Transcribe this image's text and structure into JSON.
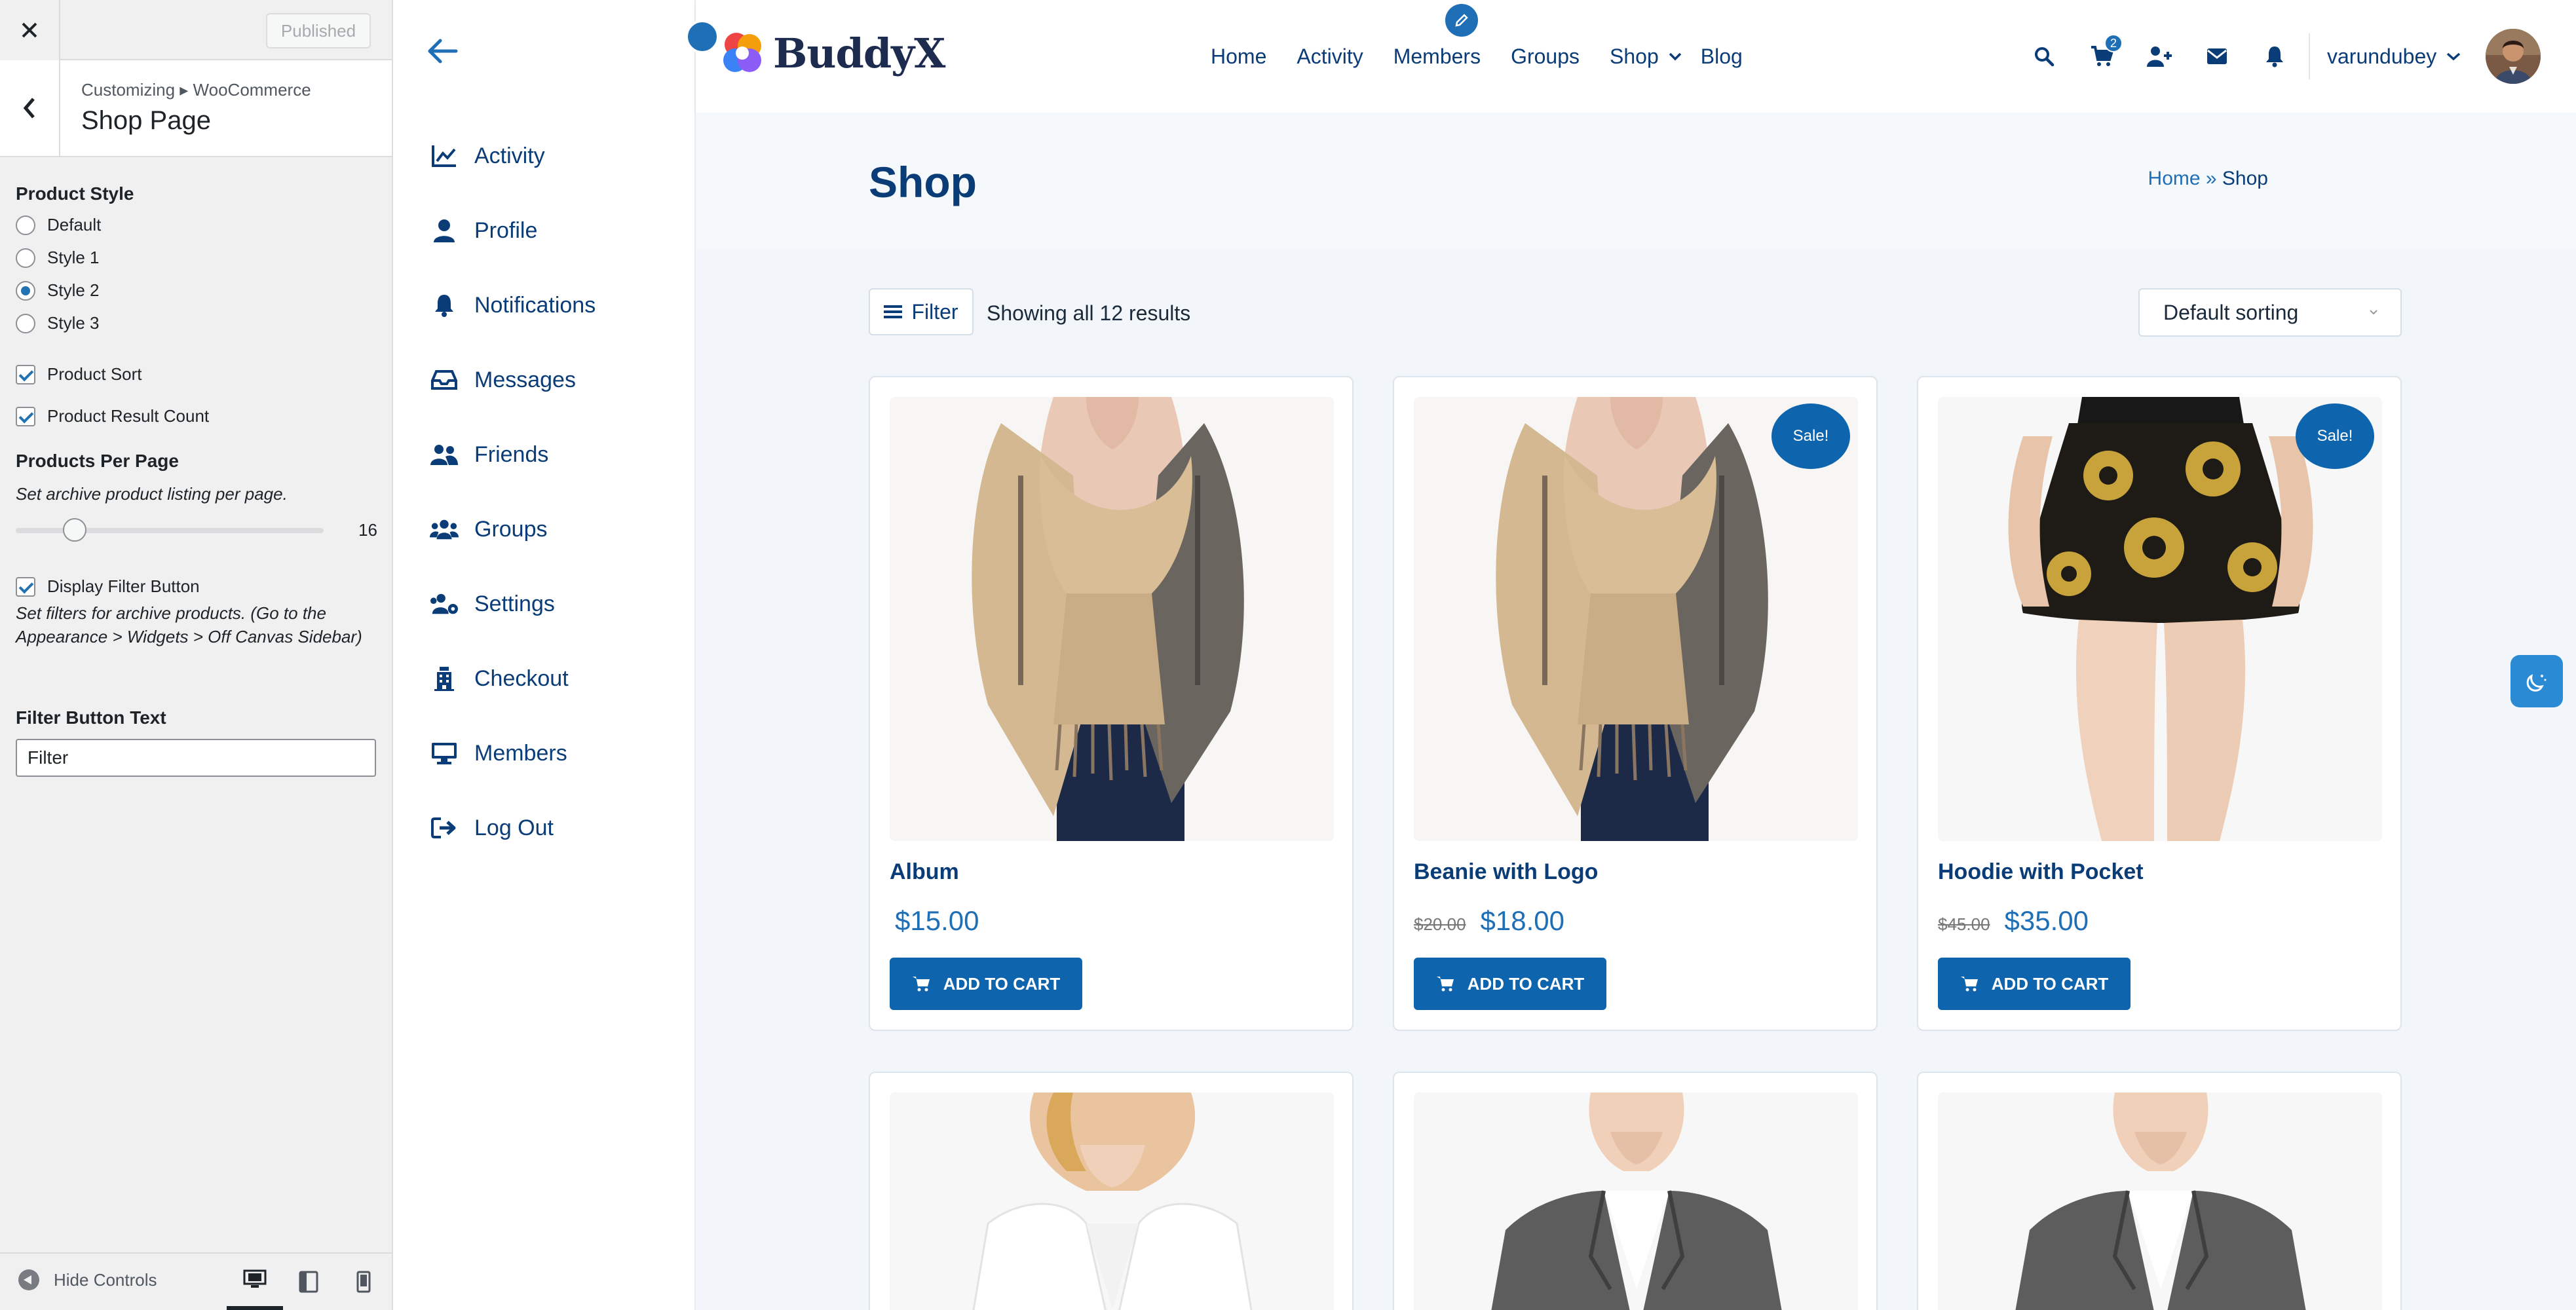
{
  "customizer": {
    "published_label": "Published",
    "breadcrumb": "Customizing ▸ WooCommerce",
    "title": "Shop Page",
    "product_style": {
      "heading": "Product Style",
      "options": [
        "Default",
        "Style 1",
        "Style 2",
        "Style 3"
      ],
      "selected": "Style 2"
    },
    "product_sort_label": "Product Sort",
    "product_result_count_label": "Product Result Count",
    "products_per_page": {
      "heading": "Products Per Page",
      "description": "Set archive product listing per page.",
      "value": "16"
    },
    "display_filter_label": "Display Filter Button",
    "display_filter_description": "Set filters for archive products. (Go to the Appearance > Widgets > Off Canvas Sidebar)",
    "filter_button_text": {
      "heading": "Filter Button Text",
      "value": "Filter"
    },
    "hide_controls_label": "Hide Controls"
  },
  "side_menu": {
    "items": [
      {
        "label": "Activity",
        "icon": "chart-line-icon"
      },
      {
        "label": "Profile",
        "icon": "user-icon"
      },
      {
        "label": "Notifications",
        "icon": "bell-icon"
      },
      {
        "label": "Messages",
        "icon": "inbox-icon"
      },
      {
        "label": "Friends",
        "icon": "user-friends-icon"
      },
      {
        "label": "Groups",
        "icon": "users-icon"
      },
      {
        "label": "Settings",
        "icon": "users-cog-icon"
      },
      {
        "label": "Checkout",
        "icon": "building-icon"
      },
      {
        "label": "Members",
        "icon": "desktop-icon"
      },
      {
        "label": "Log Out",
        "icon": "sign-out-icon"
      }
    ]
  },
  "header": {
    "logo_text": "BuddyX",
    "nav": [
      "Home",
      "Activity",
      "Members",
      "Groups",
      "Shop",
      "Blog"
    ],
    "cart_count": "2",
    "username": "varundubey"
  },
  "page": {
    "title": "Shop",
    "breadcrumb_home": "Home",
    "breadcrumb_sep": " » ",
    "breadcrumb_current": "Shop"
  },
  "shop": {
    "filter_label": "Filter",
    "result_count": "Showing all 12 results",
    "sort_label": "Default sorting",
    "products": [
      {
        "name": "Album",
        "old_price": "",
        "price": "$15.00",
        "sale": "",
        "button": "ADD TO CART"
      },
      {
        "name": "Beanie with Logo",
        "old_price": "$20.00",
        "price": "$18.00",
        "sale": "Sale!",
        "button": "ADD TO CART"
      },
      {
        "name": "Hoodie with Pocket",
        "old_price": "$45.00",
        "price": "$35.00",
        "sale": "Sale!",
        "button": "ADD TO CART"
      }
    ]
  },
  "colors": {
    "primary": "#0e64ad",
    "nav_text": "#0a3c78",
    "customizer_bg": "#f0f0f1"
  }
}
